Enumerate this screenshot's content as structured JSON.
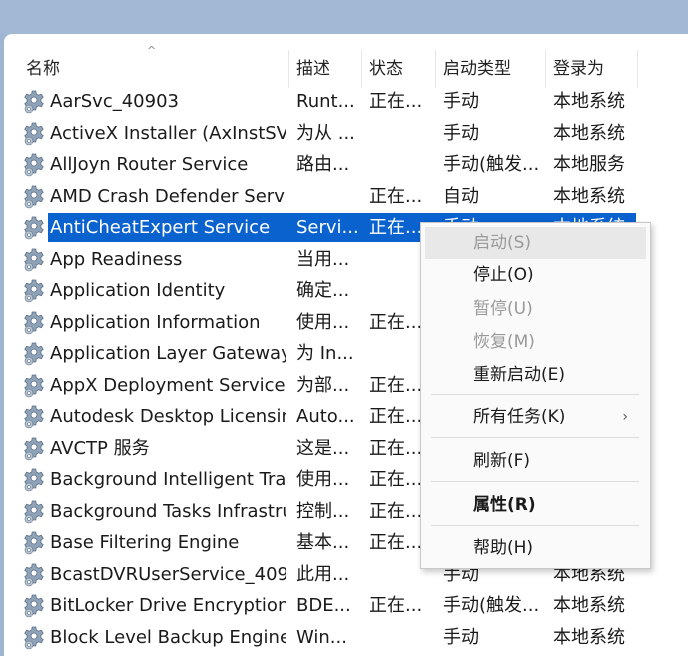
{
  "header": {
    "sort_indicator": "^",
    "columns": [
      "名称",
      "描述",
      "状态",
      "启动类型",
      "登录为"
    ]
  },
  "services": [
    {
      "name": "AarSvc_40903",
      "desc": "Runt...",
      "status": "正在...",
      "start": "手动",
      "login": "本地系统"
    },
    {
      "name": "ActiveX Installer (AxInstSV)",
      "desc": "为从 ...",
      "status": "",
      "start": "手动",
      "login": "本地系统"
    },
    {
      "name": "AllJoyn Router Service",
      "desc": "路由...",
      "status": "",
      "start": "手动(触发...",
      "login": "本地服务"
    },
    {
      "name": "AMD Crash Defender Servi...",
      "desc": "",
      "status": "正在...",
      "start": "自动",
      "login": "本地系统"
    },
    {
      "name": "AntiCheatExpert Service",
      "desc": "Servi...",
      "status": "正在...",
      "start": "手动",
      "login": "本地系统"
    },
    {
      "name": "App Readiness",
      "desc": "当用...",
      "status": "",
      "start": "",
      "login": ""
    },
    {
      "name": "Application Identity",
      "desc": "确定...",
      "status": "",
      "start": "",
      "login": ""
    },
    {
      "name": "Application Information",
      "desc": "使用...",
      "status": "正在...",
      "start": "",
      "login": ""
    },
    {
      "name": "Application Layer Gateway ...",
      "desc": "为 In...",
      "status": "",
      "start": "",
      "login": ""
    },
    {
      "name": "AppX Deployment Service ...",
      "desc": "为部...",
      "status": "正在...",
      "start": "",
      "login": ""
    },
    {
      "name": "Autodesk Desktop Licensin...",
      "desc": "Auto...",
      "status": "正在...",
      "start": "",
      "login": ""
    },
    {
      "name": "AVCTP 服务",
      "desc": "这是...",
      "status": "正在...",
      "start": "",
      "login": ""
    },
    {
      "name": "Background Intelligent Tra...",
      "desc": "使用...",
      "status": "正在...",
      "start": "",
      "login": ""
    },
    {
      "name": "Background Tasks Infrastru...",
      "desc": "控制...",
      "status": "正在...",
      "start": "",
      "login": ""
    },
    {
      "name": "Base Filtering Engine",
      "desc": "基本...",
      "status": "正在...",
      "start": "",
      "login": ""
    },
    {
      "name": "BcastDVRUserService_409...",
      "desc": "此用...",
      "status": "",
      "start": "手动",
      "login": "本地系统"
    },
    {
      "name": "BitLocker Drive Encryption ...",
      "desc": "BDE...",
      "status": "正在...",
      "start": "手动(触发...",
      "login": "本地系统"
    },
    {
      "name": "Block Level Backup Engine ...",
      "desc": "Win...",
      "status": "",
      "start": "手动",
      "login": "本地系统"
    }
  ],
  "selected_index": 4,
  "context_menu": {
    "start": "启动(S)",
    "stop": "停止(O)",
    "pause": "暂停(U)",
    "resume": "恢复(M)",
    "restart": "重新启动(E)",
    "all_tasks": "所有任务(K)",
    "all_tasks_arrow": "›",
    "refresh": "刷新(F)",
    "properties": "属性(R)",
    "help": "帮助(H)"
  },
  "colors": {
    "selection": "#0a62cf",
    "title_bar": "#a3b8d4"
  }
}
